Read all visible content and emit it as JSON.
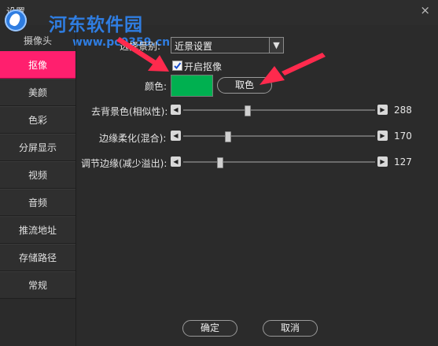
{
  "window": {
    "title": "设置",
    "close_glyph": "×"
  },
  "watermark": {
    "site_name": "河东软件园",
    "url": "www.pc0359.cn",
    "partial_tab": "摄像头"
  },
  "sidebar": {
    "items": [
      {
        "label": "抠像",
        "active": true
      },
      {
        "label": "美颜"
      },
      {
        "label": "色彩"
      },
      {
        "label": "分屏显示"
      },
      {
        "label": "视频"
      },
      {
        "label": "音频"
      },
      {
        "label": "推流地址"
      },
      {
        "label": "存储路径"
      },
      {
        "label": "常规"
      }
    ]
  },
  "keying": {
    "mode_label": "选择景别:",
    "mode_value": "近景设置",
    "enable_label": "开启抠像",
    "enable_checked": true,
    "color_label": "颜色:",
    "color_value": "#00b050",
    "pick_color_label": "取色",
    "sliders": [
      {
        "label": "去背景色(相似性):",
        "value": "288",
        "fraction": 0.33
      },
      {
        "label": "边缘柔化(混合):",
        "value": "170",
        "fraction": 0.23
      },
      {
        "label": "调节边缘(减少溢出):",
        "value": "127",
        "fraction": 0.19
      }
    ]
  },
  "footer": {
    "ok_label": "确定",
    "cancel_label": "取消"
  },
  "colors": {
    "accent": "#ff1f6e",
    "arrow": "#ff2a4d",
    "watermark": "#2f7de1"
  }
}
